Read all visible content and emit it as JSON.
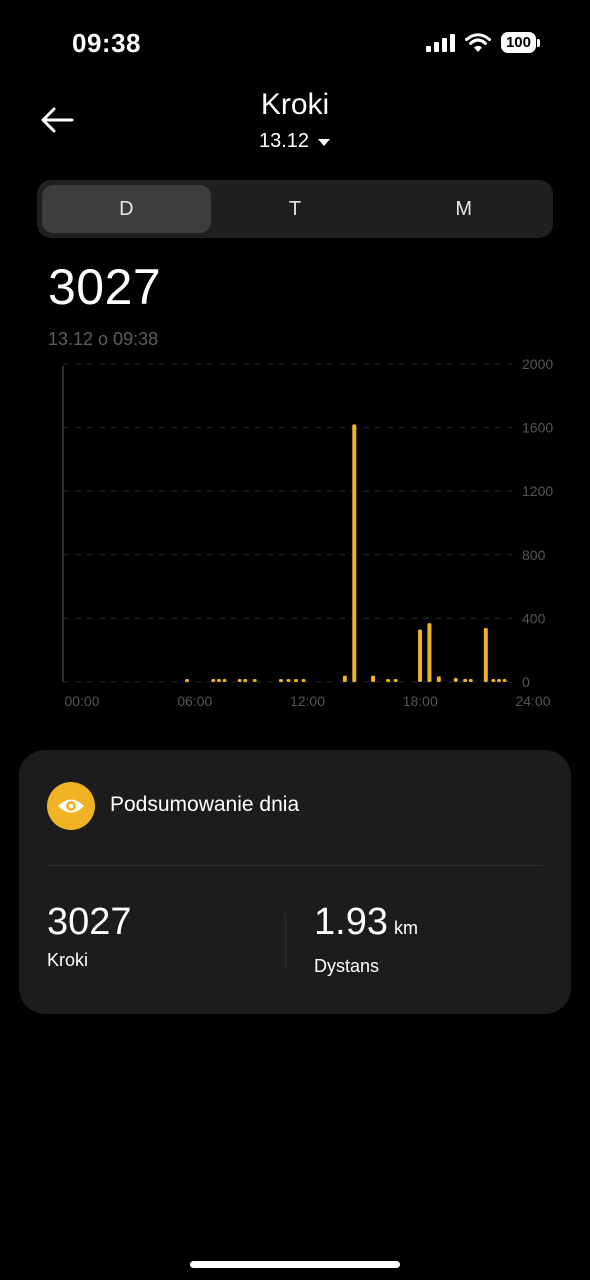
{
  "status_bar": {
    "time": "09:38",
    "battery": "100",
    "icons": [
      "cellular-signal-icon",
      "wifi-icon",
      "battery-icon"
    ]
  },
  "header": {
    "title": "Kroki",
    "date": "13.12",
    "back_icon": "arrow-left-icon",
    "dropdown_icon": "caret-down-icon"
  },
  "tabs": [
    {
      "label": "D",
      "active": true
    },
    {
      "label": "T",
      "active": false
    },
    {
      "label": "M",
      "active": false
    }
  ],
  "summary": {
    "value": "3027",
    "timestamp": "13.12 o 09:38"
  },
  "chart_data": {
    "type": "bar",
    "y_ticks": [
      "2000",
      "1600",
      "1200",
      "800",
      "400",
      "0"
    ],
    "x_ticks": [
      "00:00",
      "06:00",
      "12:00",
      "18:00",
      "24:00"
    ],
    "xlim": [
      0,
      24
    ],
    "ylim": [
      0,
      2000
    ],
    "grid": true,
    "bar_color": "#f0b324",
    "bars": [
      {
        "x": 6.6,
        "y": 4
      },
      {
        "x": 8.0,
        "y": 8
      },
      {
        "x": 8.3,
        "y": 10
      },
      {
        "x": 8.6,
        "y": 6
      },
      {
        "x": 9.4,
        "y": 6
      },
      {
        "x": 9.7,
        "y": 8
      },
      {
        "x": 10.2,
        "y": 6
      },
      {
        "x": 11.6,
        "y": 15
      },
      {
        "x": 12.0,
        "y": 5
      },
      {
        "x": 12.4,
        "y": 6
      },
      {
        "x": 12.8,
        "y": 4
      },
      {
        "x": 15.0,
        "y": 40
      },
      {
        "x": 15.5,
        "y": 1620
      },
      {
        "x": 16.5,
        "y": 40
      },
      {
        "x": 17.3,
        "y": 10
      },
      {
        "x": 17.7,
        "y": 8
      },
      {
        "x": 19.0,
        "y": 330
      },
      {
        "x": 19.5,
        "y": 370
      },
      {
        "x": 20.0,
        "y": 35
      },
      {
        "x": 20.9,
        "y": 25
      },
      {
        "x": 21.4,
        "y": 20
      },
      {
        "x": 21.7,
        "y": 12
      },
      {
        "x": 22.5,
        "y": 340
      },
      {
        "x": 22.9,
        "y": 15
      },
      {
        "x": 23.2,
        "y": 15
      },
      {
        "x": 23.5,
        "y": 12
      }
    ]
  },
  "day_summary": {
    "title": "Podsumowanie dnia",
    "icon": "eye-icon",
    "steps_value": "3027",
    "steps_label": "Kroki",
    "distance_value": "1.93",
    "distance_unit": "km",
    "distance_label": "Dystans"
  }
}
